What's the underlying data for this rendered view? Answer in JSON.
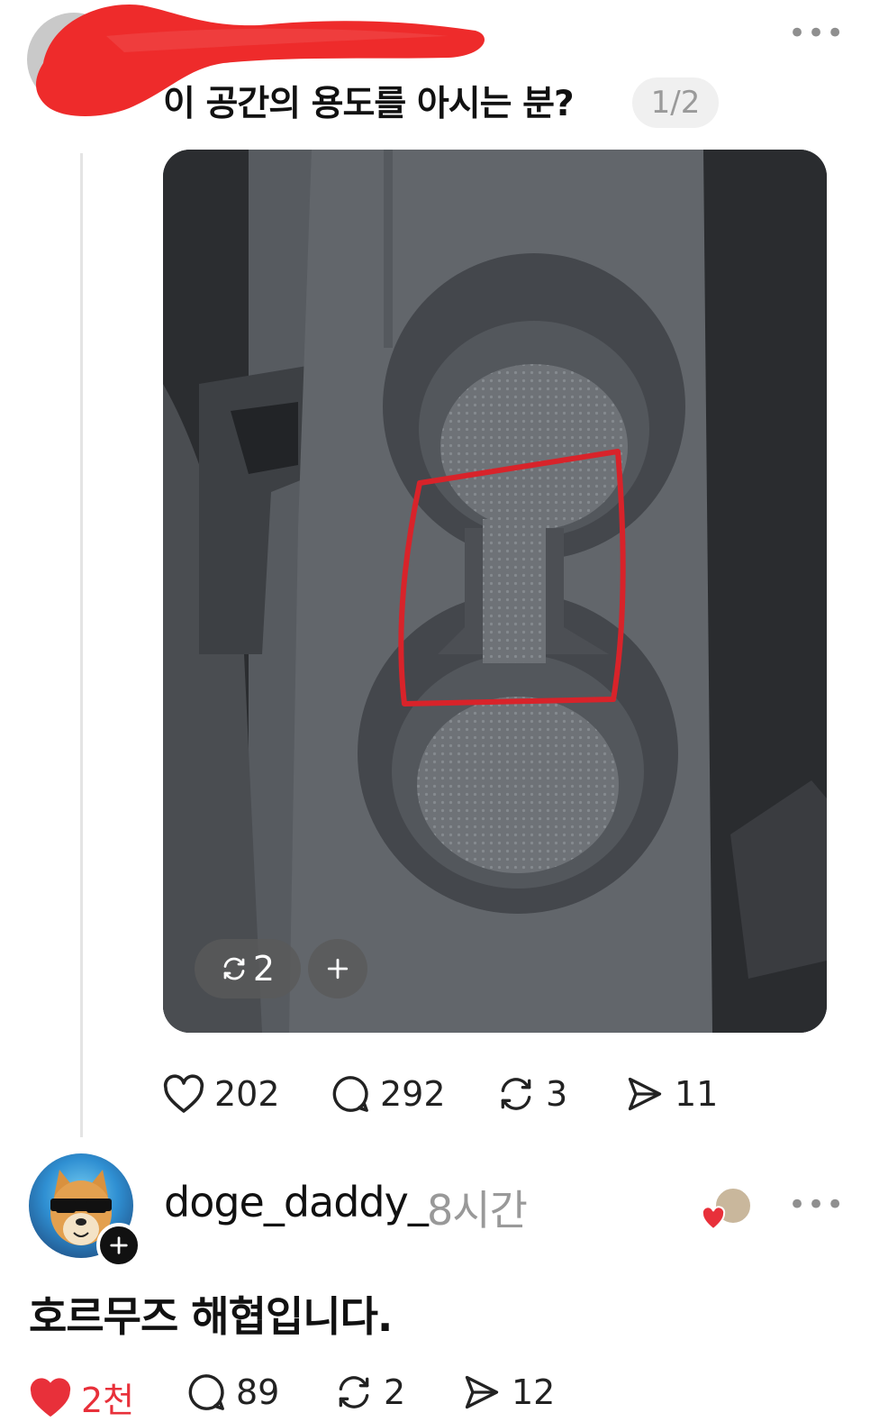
{
  "post": {
    "time_partial": "시간",
    "text": "이 공간의 용도를 아시는 분?",
    "page_indicator": "1/2",
    "more_label": "•••",
    "image_badge": {
      "repost_count": "2",
      "add_label": "+"
    },
    "actions": {
      "likes": "202",
      "comments": "292",
      "reposts": "3",
      "shares": "11"
    }
  },
  "reply": {
    "username": "doge_daddy_",
    "time": "8시간",
    "more_label": "•••",
    "text": "호르무즈 해협입니다.",
    "actions": {
      "likes": "2천",
      "comments": "89",
      "reposts": "2",
      "shares": "12"
    }
  },
  "colors": {
    "like_active": "#e8303a",
    "redaction": "#ee2b2b",
    "highlight_box": "#d8232a",
    "muted_text": "#9a9a9a"
  },
  "icons": [
    "heart-icon",
    "comment-icon",
    "repost-icon",
    "share-icon",
    "plus-icon",
    "more-icon"
  ]
}
